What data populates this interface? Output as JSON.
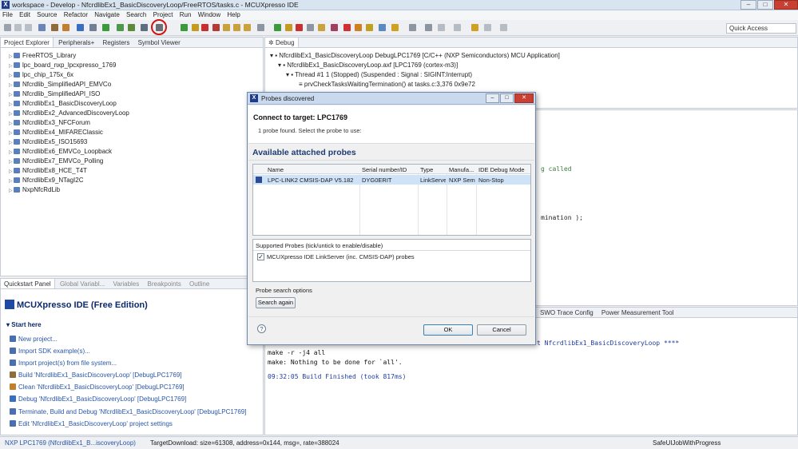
{
  "window": {
    "title": "workspace - Develop - NfcrdlibEx1_BasicDiscoveryLoop/FreeRTOS/tasks.c - MCUXpresso IDE",
    "minimize": "–",
    "maximize": "□",
    "close": "✕"
  },
  "menu": [
    "File",
    "Edit",
    "Source",
    "Refactor",
    "Navigate",
    "Search",
    "Project",
    "Run",
    "Window",
    "Help"
  ],
  "toolbar": {
    "quick_access": "Quick Access"
  },
  "project_explorer": {
    "tabs": [
      "Project Explorer",
      "Peripherals+",
      "Registers",
      "Symbol Viewer"
    ],
    "items": [
      "FreeRTOS_Library",
      "lpc_board_nxp_lpcxpresso_1769",
      "lpc_chip_175x_6x",
      "Nfcrdlib_SimplifiedAPI_EMVCo",
      "Nfcrdlib_SimplifiedAPI_ISO",
      "NfcrdlibEx1_BasicDiscoveryLoop",
      "NfcrdlibEx2_AdvancedDiscoveryLoop",
      "NfcrdlibEx3_NFCForum",
      "NfcrdlibEx4_MIFAREClassic",
      "NfcrdlibEx5_ISO15693",
      "NfcrdlibEx6_EMVCo_Loopback",
      "NfcrdlibEx7_EMVCo_Polling",
      "NfcrdlibEx8_HCE_T4T",
      "NfcrdlibEx9_NTagI2C",
      "NxpNfcRdLib"
    ]
  },
  "quickstart": {
    "tabs": [
      "Quickstart Panel",
      "Global Variabl...",
      "Variables",
      "Breakpoints",
      "Outline"
    ],
    "heading": "MCUXpresso IDE (Free Edition)",
    "section": "Start here",
    "links": [
      "New project...",
      "Import SDK example(s)...",
      "Import project(s) from file system...",
      "Build 'NfcrdlibEx1_BasicDiscoveryLoop' [DebugLPC1769]",
      "Clean 'NfcrdlibEx1_BasicDiscoveryLoop' [DebugLPC1769]",
      "Debug 'NfcrdlibEx1_BasicDiscoveryLoop' [DebugLPC1769]",
      "Terminate, Build and Debug 'NfcrdlibEx1_BasicDiscoveryLoop' [DebugLPC1769]",
      "Edit 'NfcrdlibEx1_BasicDiscoveryLoop' project settings"
    ]
  },
  "debug": {
    "tab": "Debug",
    "lines": [
      "NfcrdlibEx1_BasicDiscoveryLoop DebugLPC1769 [C/C++ (NXP Semiconductors) MCU Application]",
      "NfcrdlibEx1_BasicDiscoveryLoop.axf [LPC1769 (cortex-m3)]",
      "Thread #1 1 (Stopped) (Suspended : Signal : SIGINT:Interrupt)",
      "prvCheckTasksWaitingTermination() at tasks.c:3,376 0x9e72"
    ]
  },
  "editor": {
    "fragment1": "g called",
    "fragment2": "mination );"
  },
  "bottom_tabs": {
    "swo": "SWO Trace Config",
    "power": "Power Measurement Tool"
  },
  "console": {
    "line0": "t NfcrdlibEx1_BasicDiscoveryLoop ****",
    "line1": "make -r -j4 all",
    "line2": "make: Nothing to be done for `all'.",
    "line3": "09:32:05 Build Finished (took 817ms)"
  },
  "status": {
    "left": "NXP LPC1769 (NfcrdlibEx1_B...iscoveryLoop)",
    "middle": "TargetDownload: size=61308, address=0x144, msg=, rate=388024",
    "right": "SafeUIJobWithProgress"
  },
  "dialog": {
    "title": "Probes discovered",
    "connect": "Connect to target: LPC1769",
    "found": "1 probe found. Select the probe to use:",
    "available": "Available attached probes",
    "columns": [
      "Name",
      "Serial number/ID",
      "Type",
      "Manufa...",
      "IDE Debug Mode"
    ],
    "row": [
      "LPC-LINK2 CMSIS-DAP V5.182",
      "DYG0ERIT",
      "LinkServe",
      "NXP Sem",
      "Non-Stop"
    ],
    "supported_caption": "Supported Probes (tick/untick to enable/disable)",
    "supported_item": "MCUXpresso IDE LinkServer (inc. CMSIS-DAP) probes",
    "search_caption": "Probe search options",
    "search_again": "Search again",
    "ok": "OK",
    "cancel": "Cancel",
    "help": "?"
  },
  "colors": {
    "accent": "#1f3c8b",
    "highlight": "#d01414",
    "selection": "#cfe3f8"
  }
}
